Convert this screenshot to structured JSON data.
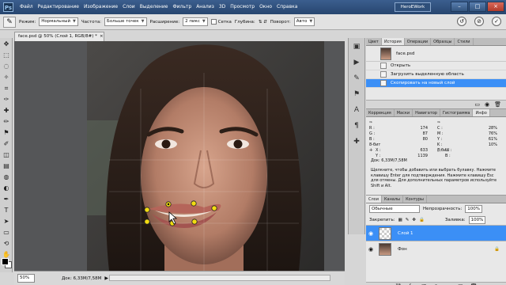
{
  "app": {
    "logo": "Ps",
    "menu": [
      "Файл",
      "Редактирование",
      "Изображение",
      "Слои",
      "Выделение",
      "Фильтр",
      "Анализ",
      "3D",
      "Просмотр",
      "Окно",
      "Справка"
    ],
    "workspace": "HeroEWork",
    "window_controls": [
      "–",
      "□",
      "×"
    ]
  },
  "options": {
    "tool_icon": "spot-healing-brush-icon",
    "mode_label": "Режим:",
    "mode_value": "Нормальный",
    "density_label": "Частота:",
    "density_value": "Больше точек",
    "expansion_label": "Расширение:",
    "expansion_value": "2 пикс",
    "grid_label": "Сетка",
    "depth_label": "Глубина:",
    "rotation_label": "Поворот:",
    "rotation_value": "Авто"
  },
  "document": {
    "tab_title": "face.psd @ 50% (Слой 1, RGB/8#) *",
    "zoom": "50%",
    "status_info": "Док: 6,33M/7,58M"
  },
  "panels": {
    "history_tabs": [
      "Цвет",
      "История",
      "Операции",
      "Образцы",
      "Стили"
    ],
    "history_snapshot": "face.psd",
    "history_items": [
      "Открыть",
      "Загрузить выделенную область",
      "Скопировать на новый слой"
    ],
    "info_tabs": [
      "Коррекция",
      "Маски",
      "Навигатор",
      "Гистограмма",
      "Инфо"
    ],
    "info": {
      "rgb_labels": [
        "R :",
        "G :",
        "B :"
      ],
      "rgb_values": [
        "174",
        "87",
        "80"
      ],
      "cmyk_labels": [
        "C :",
        "M :",
        "Y :",
        "K :"
      ],
      "cmyk_values": [
        "28%",
        "76%",
        "61%",
        "10%"
      ],
      "bit_left": "8-бит",
      "bit_right": "8-бит",
      "xy_labels": [
        "X :",
        "Y :"
      ],
      "xy_values": [
        "633",
        "1139"
      ],
      "wh_labels": [
        "Ш :",
        "В :"
      ],
      "doc": "Док: 6,33M/7,58M",
      "hint": "Щелкните, чтобы добавить или выбрать булавку. Нажмите клавишу Enter для подтверждения. Нажмите клавишу Esc для отмены. Для дополнительных параметров используйте Shift и Alt."
    },
    "layers_tabs": [
      "Слои",
      "Каналы",
      "Контуры"
    ],
    "blend_mode": "Обычные",
    "opacity_label": "Непрозрачность:",
    "opacity_value": "100%",
    "lock_label": "Закрепить:",
    "fill_label": "Заливка:",
    "fill_value": "100%",
    "layers": [
      "Слой 1",
      "Фон"
    ]
  },
  "colors": {
    "selection_blue": "#3b8ff6",
    "pin_yellow": "#f2dc12"
  },
  "puppet_pins": {
    "count": 7,
    "selected": 1
  }
}
